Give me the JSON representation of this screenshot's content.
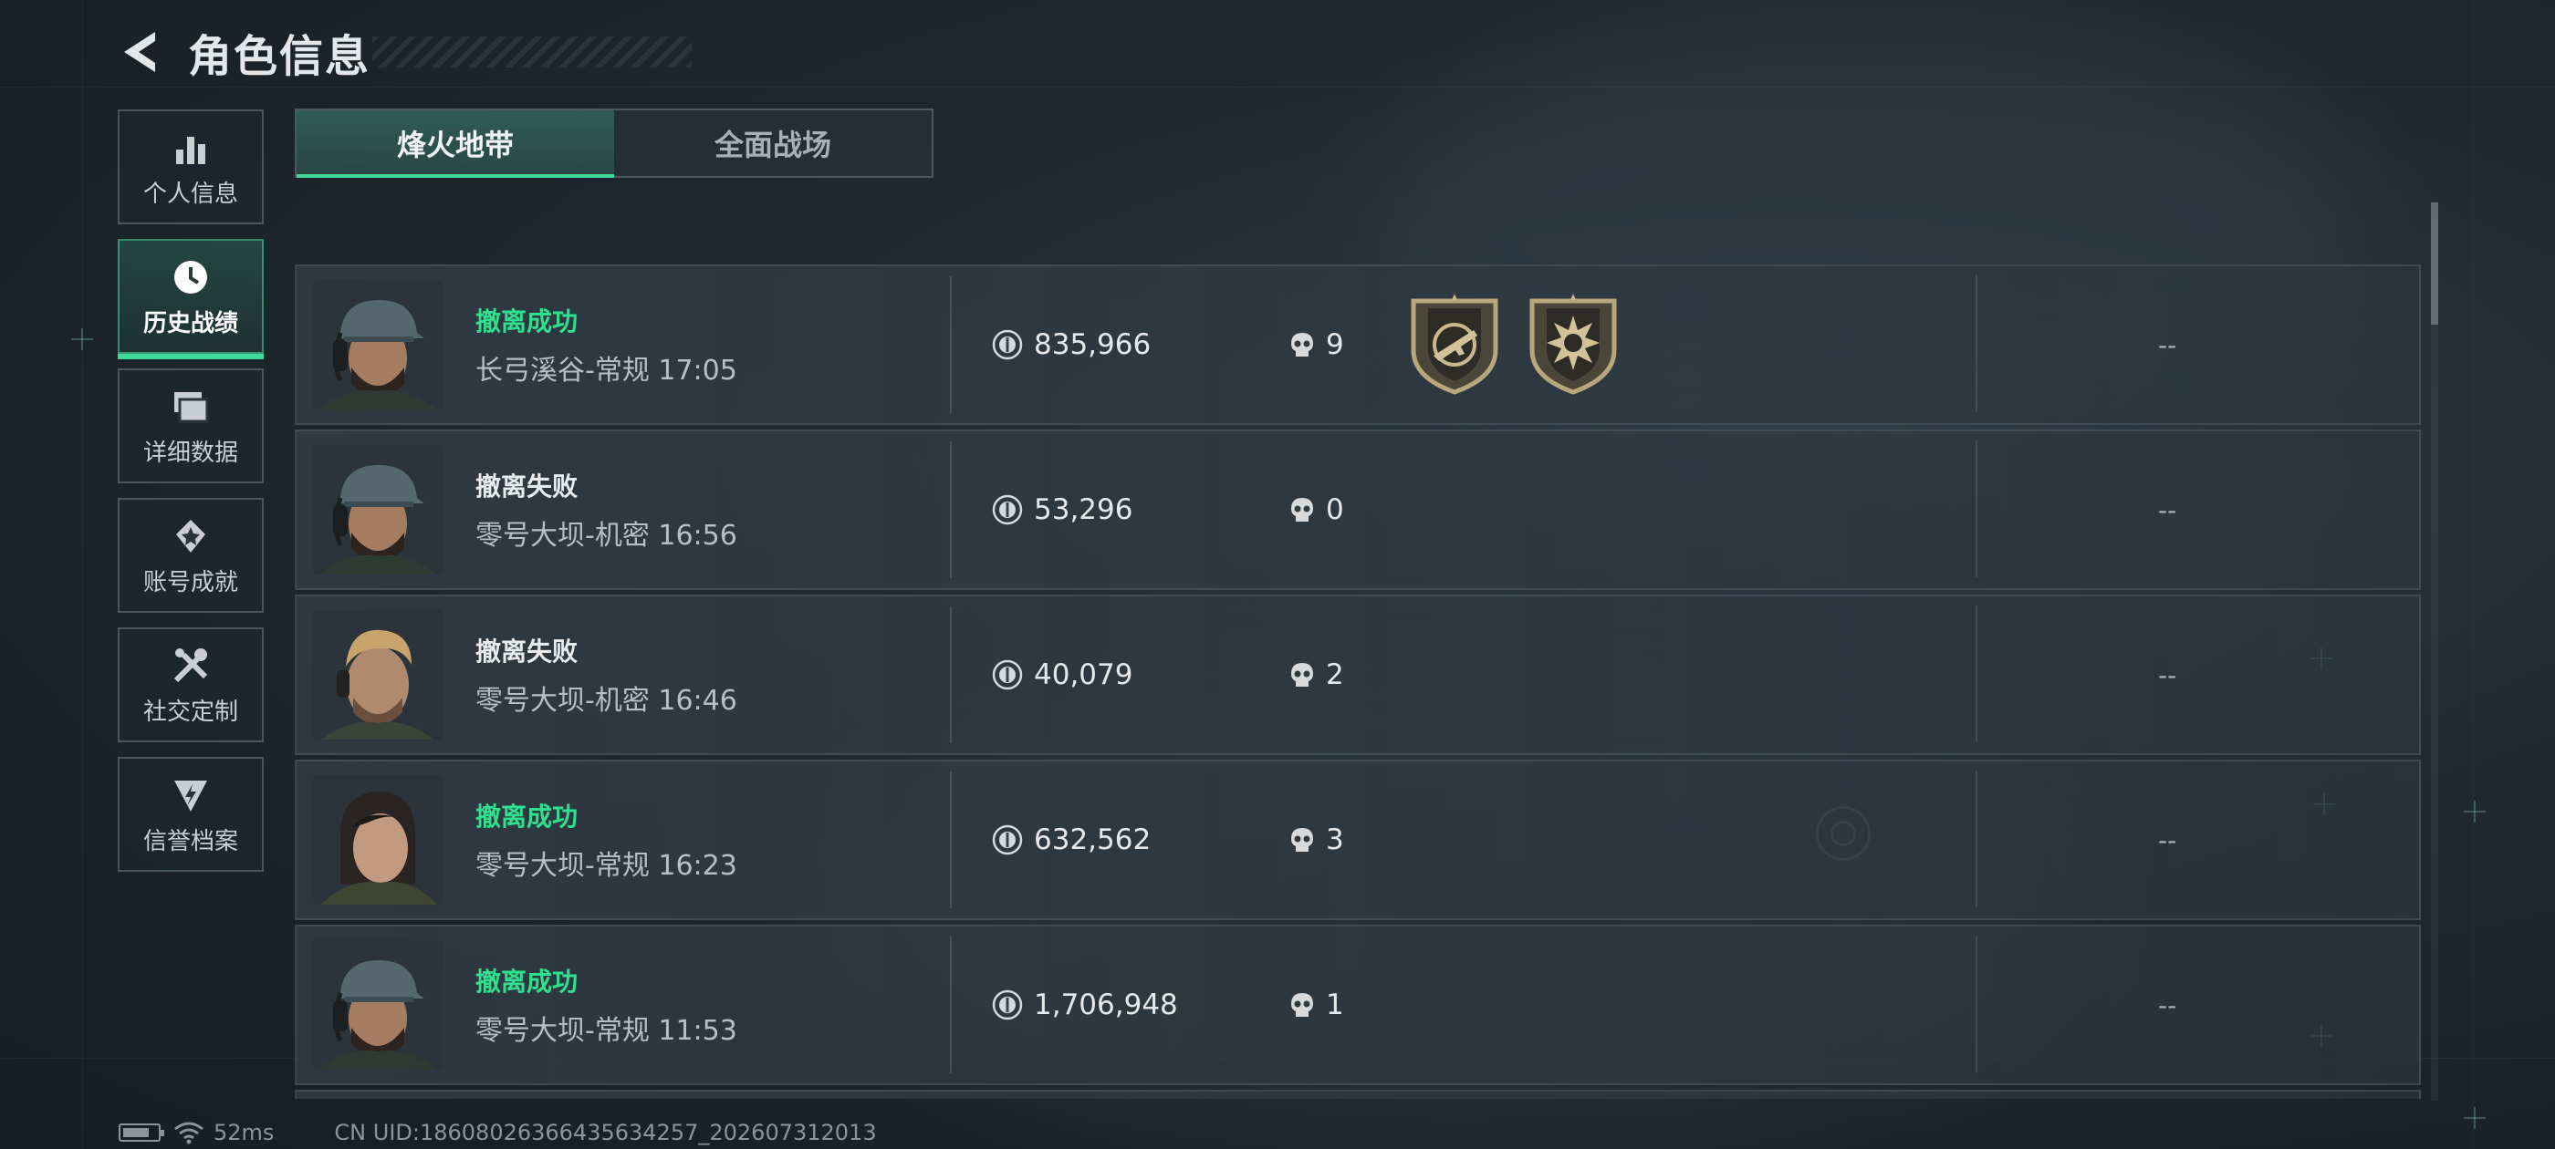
{
  "header": {
    "title": "角色信息"
  },
  "sidebar": {
    "items": [
      {
        "label": "个人信息",
        "icon": "bar-chart-icon",
        "active": false
      },
      {
        "label": "历史战绩",
        "icon": "history-clock-icon",
        "active": true
      },
      {
        "label": "详细数据",
        "icon": "cards-icon",
        "active": false
      },
      {
        "label": "账号成就",
        "icon": "achievement-icon",
        "active": false
      },
      {
        "label": "社交定制",
        "icon": "tools-icon",
        "active": false
      },
      {
        "label": "信誉档案",
        "icon": "shield-lightning-icon",
        "active": false
      }
    ]
  },
  "tabs": [
    {
      "label": "烽火地带",
      "active": true
    },
    {
      "label": "全面战场",
      "active": false
    }
  ],
  "records": [
    {
      "status": "撤离成功",
      "success": true,
      "map": "长弓溪谷-常规 17:05",
      "value": "835,966",
      "kills": "9",
      "avatar": "cap-operator",
      "badges": [
        "rifle-shield-badge",
        "skull-burst-badge"
      ],
      "extra": "--"
    },
    {
      "status": "撤离失败",
      "success": false,
      "map": "零号大坝-机密 16:56",
      "value": "53,296",
      "kills": "0",
      "avatar": "cap-operator",
      "badges": [],
      "extra": "--"
    },
    {
      "status": "撤离失败",
      "success": false,
      "map": "零号大坝-机密 16:46",
      "value": "40,079",
      "kills": "2",
      "avatar": "blond-operator",
      "badges": [],
      "extra": "--"
    },
    {
      "status": "撤离成功",
      "success": true,
      "map": "零号大坝-常规 16:23",
      "value": "632,562",
      "kills": "3",
      "avatar": "female-operator",
      "badges": [],
      "extra": "--"
    },
    {
      "status": "撤离成功",
      "success": true,
      "map": "零号大坝-常规 11:53",
      "value": "1,706,948",
      "kills": "1",
      "avatar": "cap-operator",
      "badges": [],
      "extra": "--"
    }
  ],
  "footer": {
    "ping": "52ms",
    "uid": "CN UID:18608026366435634257_202607312013"
  },
  "colors": {
    "accent": "#3fd99a",
    "success": "#2fe08f",
    "background": "#1f2830"
  }
}
